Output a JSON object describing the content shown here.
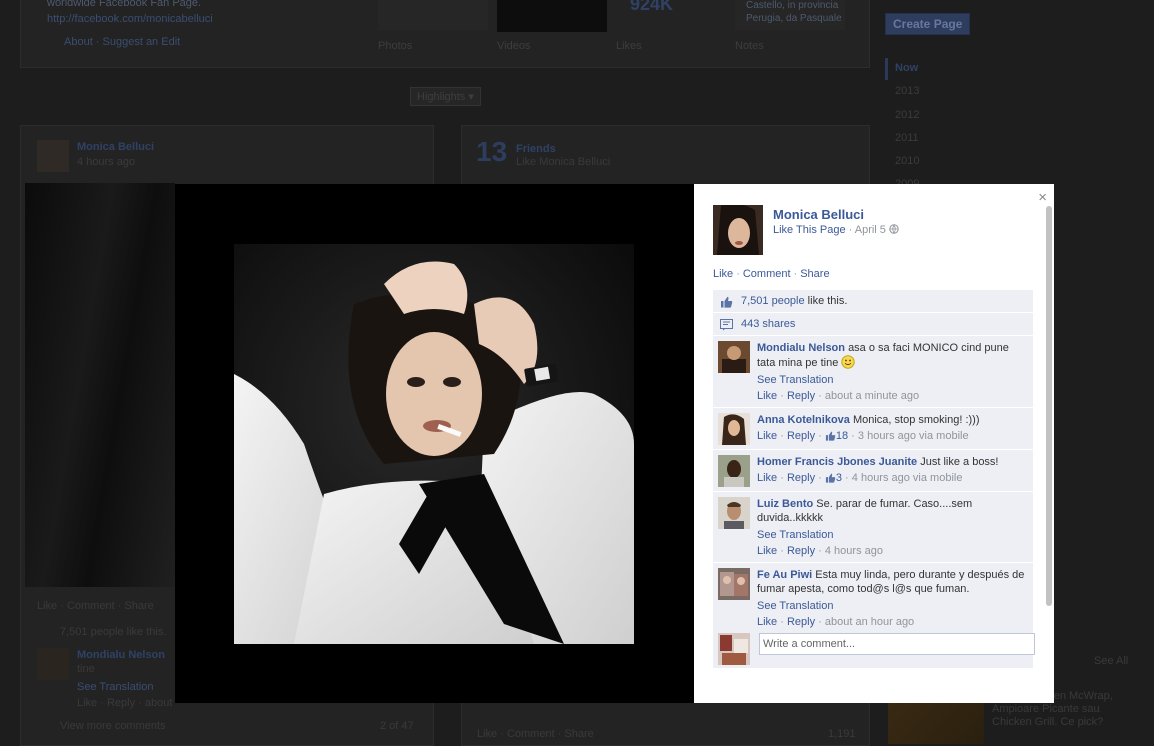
{
  "background": {
    "about_line1": "worldwide Facebook Fan Page.",
    "about_url": "http://facebook.com/monicabelluci",
    "about_links": "About · Suggest an Edit",
    "nav_photos": "Photos",
    "nav_videos": "Videos",
    "nav_likes": "Likes",
    "nav_notes": "Notes",
    "likes_count_partial": "924K",
    "place_text_1": "Castello, in provincia",
    "place_text_2": "Perugia, da Pasquale",
    "create_page": "Create Page",
    "timeline_now": "Now",
    "timeline_years": [
      "2013",
      "2012",
      "2011",
      "2010",
      "2009"
    ],
    "highlights": "Highlights ▾",
    "post_author": "Monica Belluci",
    "post_time": "4 hours ago",
    "friends_count": "13",
    "friends_title": "Friends",
    "friends_sub": "Like Monica Belluci",
    "post_actions": "Like · Comment · Share",
    "post_likes": "7,501 people like this.",
    "post_commenter": "Mondialu Nelson",
    "post_comment_tail": "tine",
    "post_see_translation": "See Translation",
    "post_like_reply": "Like · Reply · about",
    "view_more": "View more comments",
    "pager": "2 of 47",
    "see_all": "See All",
    "ad_text": "Crispy Chicken McWrap, Ampioare Picante sau Chicken Grill. Ce pick?",
    "bottom_actions": "Like · Comment · Share",
    "bottom_count": "1,191"
  },
  "panel": {
    "close": "×",
    "owner_name": "Monica Belluci",
    "like_page": "Like This Page",
    "date": "April 5",
    "actions": {
      "like": "Like",
      "comment": "Comment",
      "share": "Share"
    },
    "likes": {
      "count_text": "7,501 people",
      "suffix": " like this."
    },
    "shares": "443 shares",
    "comments": [
      {
        "name": "Mondialu Nelson",
        "text": "asa o sa faci MONICO cind pune tata mina pe tine",
        "emoticon": true,
        "see_translation": "See Translation",
        "like": "Like",
        "reply": "Reply",
        "like_count": "",
        "time": "about a minute ago"
      },
      {
        "name": "Anna Kotelnikova",
        "text": "Monica, stop smoking! :)))",
        "emoticon": false,
        "see_translation": "",
        "like": "Like",
        "reply": "Reply",
        "like_count": "18",
        "time": "3 hours ago via mobile"
      },
      {
        "name": "Homer Francis Jbones Juanite",
        "text": "Just like a boss!",
        "emoticon": false,
        "see_translation": "",
        "like": "Like",
        "reply": "Reply",
        "like_count": "3",
        "time": "4 hours ago via mobile"
      },
      {
        "name": "Luiz Bento",
        "text": "Se. parar de fumar. Caso....sem duvida..kkkkk",
        "emoticon": false,
        "see_translation": "See Translation",
        "like": "Like",
        "reply": "Reply",
        "like_count": "",
        "time": "4 hours ago"
      },
      {
        "name": "Fe Au Piwi",
        "text": "Esta muy linda, pero durante y después de fumar apesta, como tod@s l@s que fuman.",
        "emoticon": false,
        "see_translation": "See Translation",
        "like": "Like",
        "reply": "Reply",
        "like_count": "",
        "time": "about an hour ago"
      }
    ],
    "write_placeholder": "Write a comment..."
  }
}
